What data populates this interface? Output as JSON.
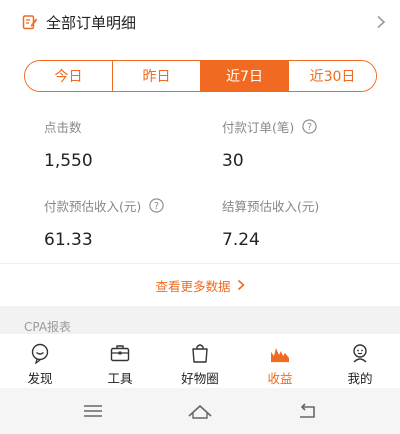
{
  "header": {
    "title": "全部订单明细"
  },
  "tabs": [
    {
      "label": "今日"
    },
    {
      "label": "昨日"
    },
    {
      "label": "近7日"
    },
    {
      "label": "近30日"
    }
  ],
  "active_tab": "近7日",
  "stats": {
    "clicks": {
      "label": "点击数",
      "value": "1,550"
    },
    "paid_orders": {
      "label": "付款订单(笔)",
      "value": "30"
    },
    "paid_income": {
      "label": "付款预估收入(元)",
      "value": "61.33"
    },
    "settled_income": {
      "label": "结算预估收入(元)",
      "value": "7.24"
    }
  },
  "more_link": {
    "label": "查看更多数据"
  },
  "section": {
    "title": "CPA报表"
  },
  "bottom_nav": [
    {
      "label": "发现",
      "icon": "discover-icon"
    },
    {
      "label": "工具",
      "icon": "toolbox-icon"
    },
    {
      "label": "好物圈",
      "icon": "shopping-bag-icon"
    },
    {
      "label": "收益",
      "icon": "earnings-chart-icon"
    },
    {
      "label": "我的",
      "icon": "profile-icon"
    }
  ],
  "colors": {
    "accent": "#f06a22",
    "text": "#222222",
    "muted": "#888888"
  }
}
